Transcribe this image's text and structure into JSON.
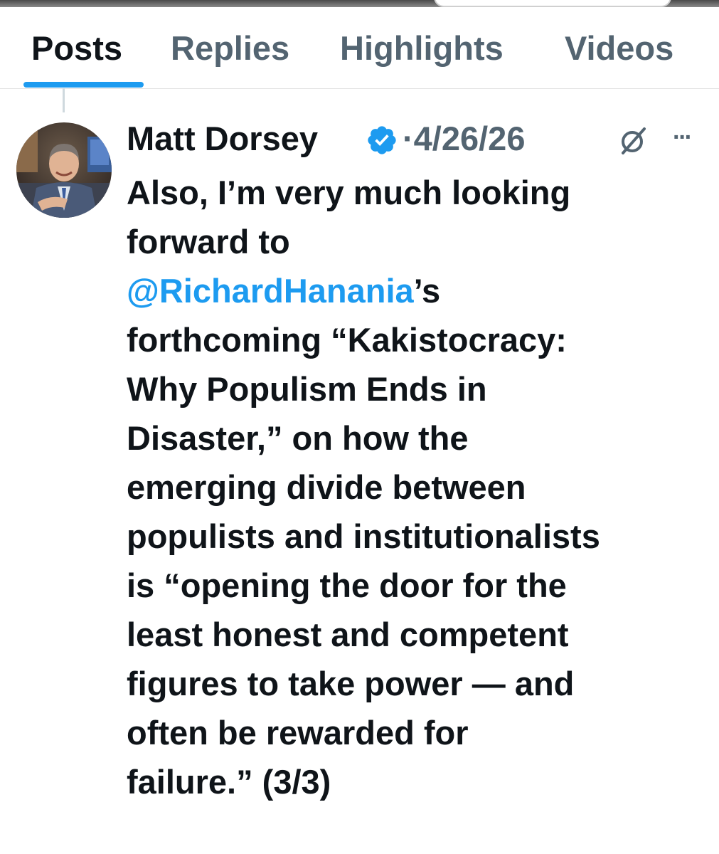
{
  "tabs": [
    {
      "label": "Posts",
      "active": true
    },
    {
      "label": "Replies",
      "active": false
    },
    {
      "label": "Highlights",
      "active": false
    },
    {
      "label": "Videos",
      "active": false
    }
  ],
  "post": {
    "author_name": "Matt Dorsey",
    "verified": true,
    "date": "·4/26/26",
    "more_label": "···",
    "body_lines": [
      {
        "text": "Also, I’m very much looking"
      },
      {
        "text": "forward to"
      },
      {
        "mention": "@RichardHanania",
        "text": "’s"
      },
      {
        "text": "forthcoming “Kakistocracy:"
      },
      {
        "text": "Why Populism Ends in"
      },
      {
        "text": "Disaster,” on how the"
      },
      {
        "text": "emerging divide between"
      },
      {
        "text": "populists and institutionalists"
      },
      {
        "text": "is “opening the door for the"
      },
      {
        "text": "least honest and competent"
      },
      {
        "text": "figures to take power — and"
      },
      {
        "text": "often be rewarded for"
      },
      {
        "text": "failure.” (3/3)"
      }
    ]
  },
  "icons": {
    "verified": "verified-badge-icon",
    "grok": "grok-icon",
    "more": "more-options-icon"
  },
  "colors": {
    "accent": "#1d9bf0",
    "secondary_text": "#536471",
    "primary_text": "#0f1419"
  }
}
